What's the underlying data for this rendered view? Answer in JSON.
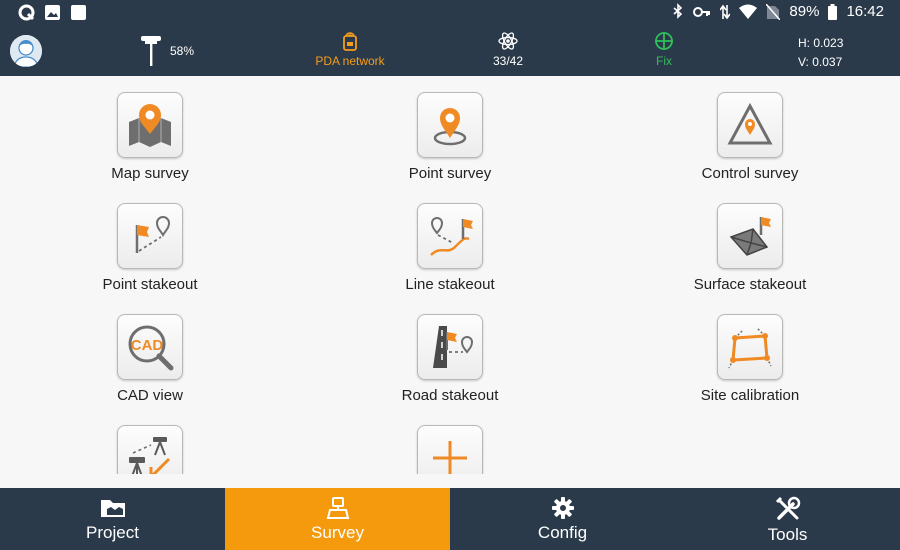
{
  "status_bar": {
    "battery": "89%",
    "time": "16:42",
    "left_icons": [
      "q-icon",
      "image-icon",
      "square-icon"
    ],
    "right_icons": [
      "bluetooth-icon",
      "key-icon",
      "data-arrows-icon",
      "wifi-icon",
      "no-sim-icon",
      "battery-icon"
    ]
  },
  "info_bar": {
    "rover_battery": "58%",
    "network": "PDA network",
    "satellites": "33/42",
    "solution": "Fix",
    "h_precision": "H: 0.023",
    "v_precision": "V: 0.037"
  },
  "grid": {
    "items": [
      {
        "label": "Map survey",
        "icon": "map-survey-icon"
      },
      {
        "label": "Point survey",
        "icon": "point-survey-icon"
      },
      {
        "label": "Control survey",
        "icon": "control-survey-icon"
      },
      {
        "label": "Point stakeout",
        "icon": "point-stakeout-icon"
      },
      {
        "label": "Line stakeout",
        "icon": "line-stakeout-icon"
      },
      {
        "label": "Surface stakeout",
        "icon": "surface-stakeout-icon"
      },
      {
        "label": "CAD view",
        "icon": "cad-view-icon",
        "icon_text": "CAD"
      },
      {
        "label": "Road stakeout",
        "icon": "road-stakeout-icon"
      },
      {
        "label": "Site calibration",
        "icon": "site-calibration-icon"
      },
      {
        "label": "",
        "icon": "instrument-transfer-icon"
      },
      {
        "label": "",
        "icon": "add-icon"
      }
    ]
  },
  "bottom_nav": {
    "items": [
      {
        "label": "Project",
        "icon": "folder-icon"
      },
      {
        "label": "Survey",
        "icon": "survey-icon",
        "active": true
      },
      {
        "label": "Config",
        "icon": "gear-icon"
      },
      {
        "label": "Tools",
        "icon": "tools-icon"
      }
    ]
  },
  "colors": {
    "bar_background": "#2b3a4a",
    "accent_orange": "#f59a0c",
    "fix_green": "#2fbf5a"
  }
}
